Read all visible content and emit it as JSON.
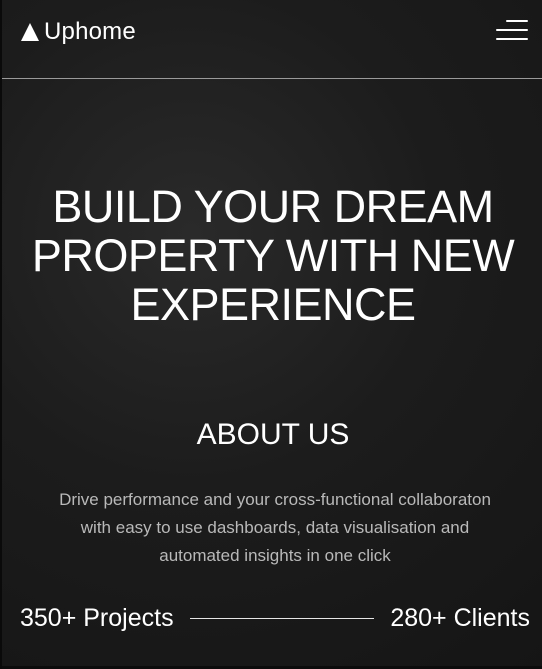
{
  "header": {
    "brand": "Uphome",
    "logo_icon": "triangle-logo-icon",
    "menu_icon": "hamburger-menu-icon"
  },
  "hero": {
    "line1": "BUILD YOUR DREAM",
    "line2": "PROPERTY WITH NEW",
    "line3": "EXPERIENCE"
  },
  "about": {
    "title": "ABOUT US",
    "line1": "Drive performance and your cross-functional collaboraton",
    "line2": "with easy to use dashboards, data visualisation and",
    "line3": "automated insights in one click"
  },
  "stats": {
    "projects": "350+ Projects",
    "clients": "280+ Clients"
  },
  "colors": {
    "background": "#1c1c1c",
    "text": "#ffffff",
    "muted_text": "#b9b9b9",
    "divider": "#9a9a9a"
  }
}
